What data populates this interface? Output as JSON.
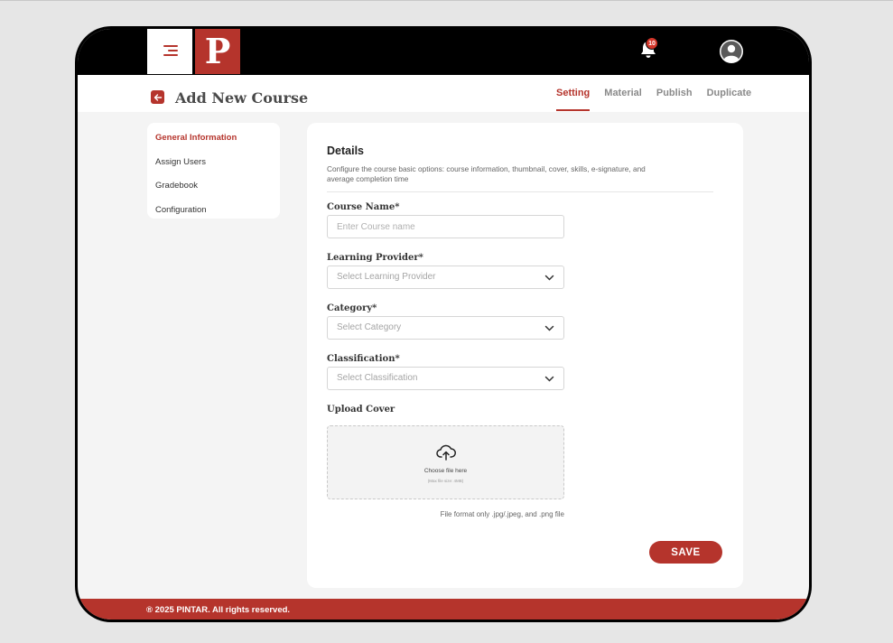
{
  "app": {
    "logo_letter": "P"
  },
  "notifications": {
    "count": "10"
  },
  "header": {
    "title": "Add New Course"
  },
  "tabs": [
    {
      "label": "Setting",
      "active": true
    },
    {
      "label": "Material"
    },
    {
      "label": "Publish"
    },
    {
      "label": "Duplicate"
    }
  ],
  "sidebar": {
    "items": [
      {
        "label": "General Information",
        "active": true
      },
      {
        "label": "Assign Users"
      },
      {
        "label": "Gradebook"
      },
      {
        "label": "Configuration"
      }
    ]
  },
  "details": {
    "title": "Details",
    "description": "Configure the course basic options: course information, thumbnail, cover, skills, e-signature, and average completion time"
  },
  "form": {
    "course_name": {
      "label": "Course Name*",
      "placeholder": "Enter Course name",
      "value": ""
    },
    "learning_provider": {
      "label": "Learning Provider*",
      "placeholder": "Select Learning Provider"
    },
    "category": {
      "label": "Category*",
      "placeholder": "Select Category"
    },
    "classification": {
      "label": "Classification*",
      "placeholder": "Select Classification"
    },
    "upload_cover": {
      "label": "Upload Cover",
      "choose_text": "Choose file here",
      "max_text": "(Max file size: 4MB)",
      "format_note": "File format only .jpg/.jpeg, and .png file"
    },
    "save_label": "SAVE"
  },
  "footer": {
    "text": "® 2025 PINTAR. All rights reserved."
  },
  "colors": {
    "brand": "#b5342c",
    "badge": "#d3362a",
    "topbar": "#000000",
    "page_bg": "#f4f4f4"
  },
  "icons": {
    "menu": "hamburger-icon",
    "notifications": "bell-icon",
    "profile": "user-avatar-icon",
    "back": "arrow-left-icon",
    "select": "chevron-down-icon",
    "upload": "cloud-upload-icon"
  }
}
